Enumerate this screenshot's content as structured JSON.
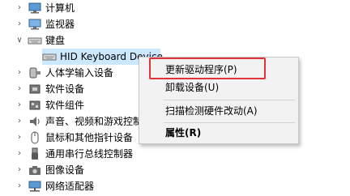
{
  "tree": {
    "items": [
      {
        "label": "计算机",
        "icon": "computer-icon",
        "expanded": false
      },
      {
        "label": "监视器",
        "icon": "monitor-icon",
        "expanded": false
      },
      {
        "label": "键盘",
        "icon": "keyboard-icon",
        "expanded": true
      },
      {
        "label": "HID Keyboard Device",
        "icon": "keyboard-device-icon",
        "child": true,
        "selected": true
      },
      {
        "label": "人体学输入设备",
        "icon": "hid-icon",
        "expanded": false
      },
      {
        "label": "软件设备",
        "icon": "software-device-icon",
        "expanded": false
      },
      {
        "label": "软件组件",
        "icon": "software-component-icon",
        "expanded": false
      },
      {
        "label": "声音、视频和游戏控制器",
        "icon": "speaker-icon",
        "expanded": false
      },
      {
        "label": "鼠标和其他指针设备",
        "icon": "mouse-icon",
        "expanded": false
      },
      {
        "label": "通用串行总线控制器",
        "icon": "usb-icon",
        "expanded": false
      },
      {
        "label": "图像设备",
        "icon": "camera-icon",
        "expanded": false
      },
      {
        "label": "网络适配器",
        "icon": "network-icon",
        "expanded": false
      }
    ]
  },
  "context_menu": {
    "items": [
      {
        "label": "更新驱动程序(P)",
        "highlighted": true
      },
      {
        "label": "卸载设备(U)"
      },
      {
        "label": "扫描检测硬件改动(A)"
      },
      {
        "label": "属性(R)",
        "bold": true
      }
    ]
  },
  "colors": {
    "selection": "#cce8ff",
    "highlight_box": "#e0333a",
    "menu_background": "#f2f2f2"
  }
}
